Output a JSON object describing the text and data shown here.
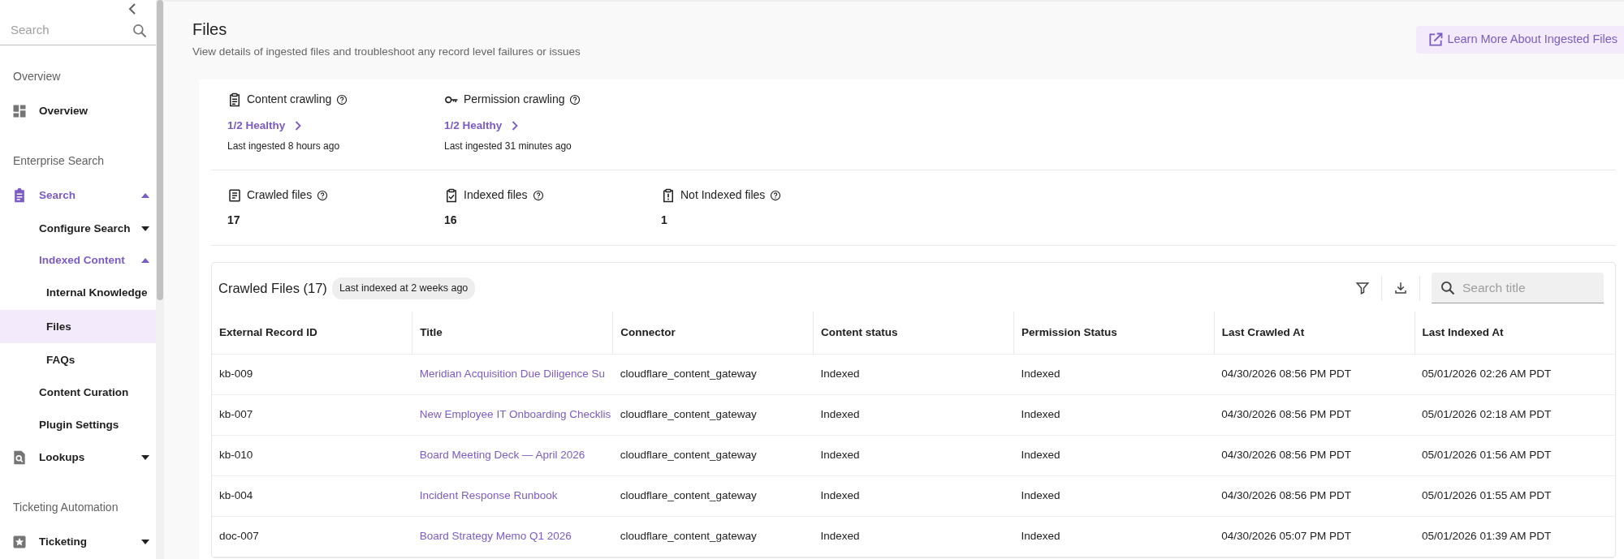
{
  "sidebar": {
    "search": {
      "placeholder": "Search"
    },
    "sections": [
      {
        "heading": "Overview",
        "items": [
          {
            "label": "Overview",
            "selected": false
          }
        ]
      },
      {
        "heading": "Enterprise Search",
        "items": [
          {
            "label": "Search",
            "selected": false,
            "expanded": true,
            "children": [
              {
                "label": "Configure Search",
                "selected": false,
                "expanded": false
              },
              {
                "label": "Indexed Content",
                "selected": false,
                "expanded": true,
                "children": [
                  {
                    "label": "Internal Knowledge",
                    "selected": false
                  },
                  {
                    "label": "Files",
                    "selected": true
                  },
                  {
                    "label": "FAQs",
                    "selected": false
                  }
                ]
              },
              {
                "label": "Content Curation",
                "selected": false
              },
              {
                "label": "Plugin Settings",
                "selected": false
              }
            ]
          },
          {
            "label": "Lookups",
            "selected": false,
            "expanded": false
          }
        ]
      },
      {
        "heading": "Ticketing Automation",
        "items": [
          {
            "label": "Ticketing",
            "selected": false,
            "expanded": false
          }
        ]
      }
    ]
  },
  "header": {
    "title": "Files",
    "subtitle": "View details of ingested files and troubleshoot any record level failures or issues",
    "learn_more_button": "Learn More About Ingested Files"
  },
  "crawling": [
    {
      "label": "Content crawling",
      "status": "1/2 Healthy",
      "detail": "Last ingested 8 hours ago"
    },
    {
      "label": "Permission crawling",
      "status": "1/2 Healthy",
      "detail": "Last ingested 31 minutes ago"
    }
  ],
  "counts": [
    {
      "label": "Crawled files",
      "value": "17"
    },
    {
      "label": "Indexed files",
      "value": "16"
    },
    {
      "label": "Not Indexed files",
      "value": "1"
    }
  ],
  "table": {
    "title": "Crawled Files (17)",
    "badge": "Last indexed at 2 weeks ago",
    "search": {
      "placeholder": "Search title"
    },
    "columns": [
      "External Record ID",
      "Title",
      "Connector",
      "Content status",
      "Permission Status",
      "Last Crawled At",
      "Last Indexed At"
    ],
    "rows": [
      [
        "kb-009",
        "Meridian Acquisition Due Diligence Su",
        "cloudflare_content_gateway",
        "Indexed",
        "Indexed",
        "04/30/2026 08:56 PM PDT",
        "05/01/2026 02:26 AM PDT"
      ],
      [
        "kb-007",
        "New Employee IT Onboarding Checklis",
        "cloudflare_content_gateway",
        "Indexed",
        "Indexed",
        "04/30/2026 08:56 PM PDT",
        "05/01/2026 02:18 AM PDT"
      ],
      [
        "kb-010",
        "Board Meeting Deck — April 2026",
        "cloudflare_content_gateway",
        "Indexed",
        "Indexed",
        "04/30/2026 08:56 PM PDT",
        "05/01/2026 01:56 AM PDT"
      ],
      [
        "kb-004",
        "Incident Response Runbook",
        "cloudflare_content_gateway",
        "Indexed",
        "Indexed",
        "04/30/2026 08:56 PM PDT",
        "05/01/2026 01:55 AM PDT"
      ],
      [
        "doc-007",
        "Board Strategy Memo Q1 2026",
        "cloudflare_content_gateway",
        "Indexed",
        "Indexed",
        "04/30/2026 05:07 PM PDT",
        "05/01/2026 01:39 AM PDT"
      ]
    ]
  }
}
